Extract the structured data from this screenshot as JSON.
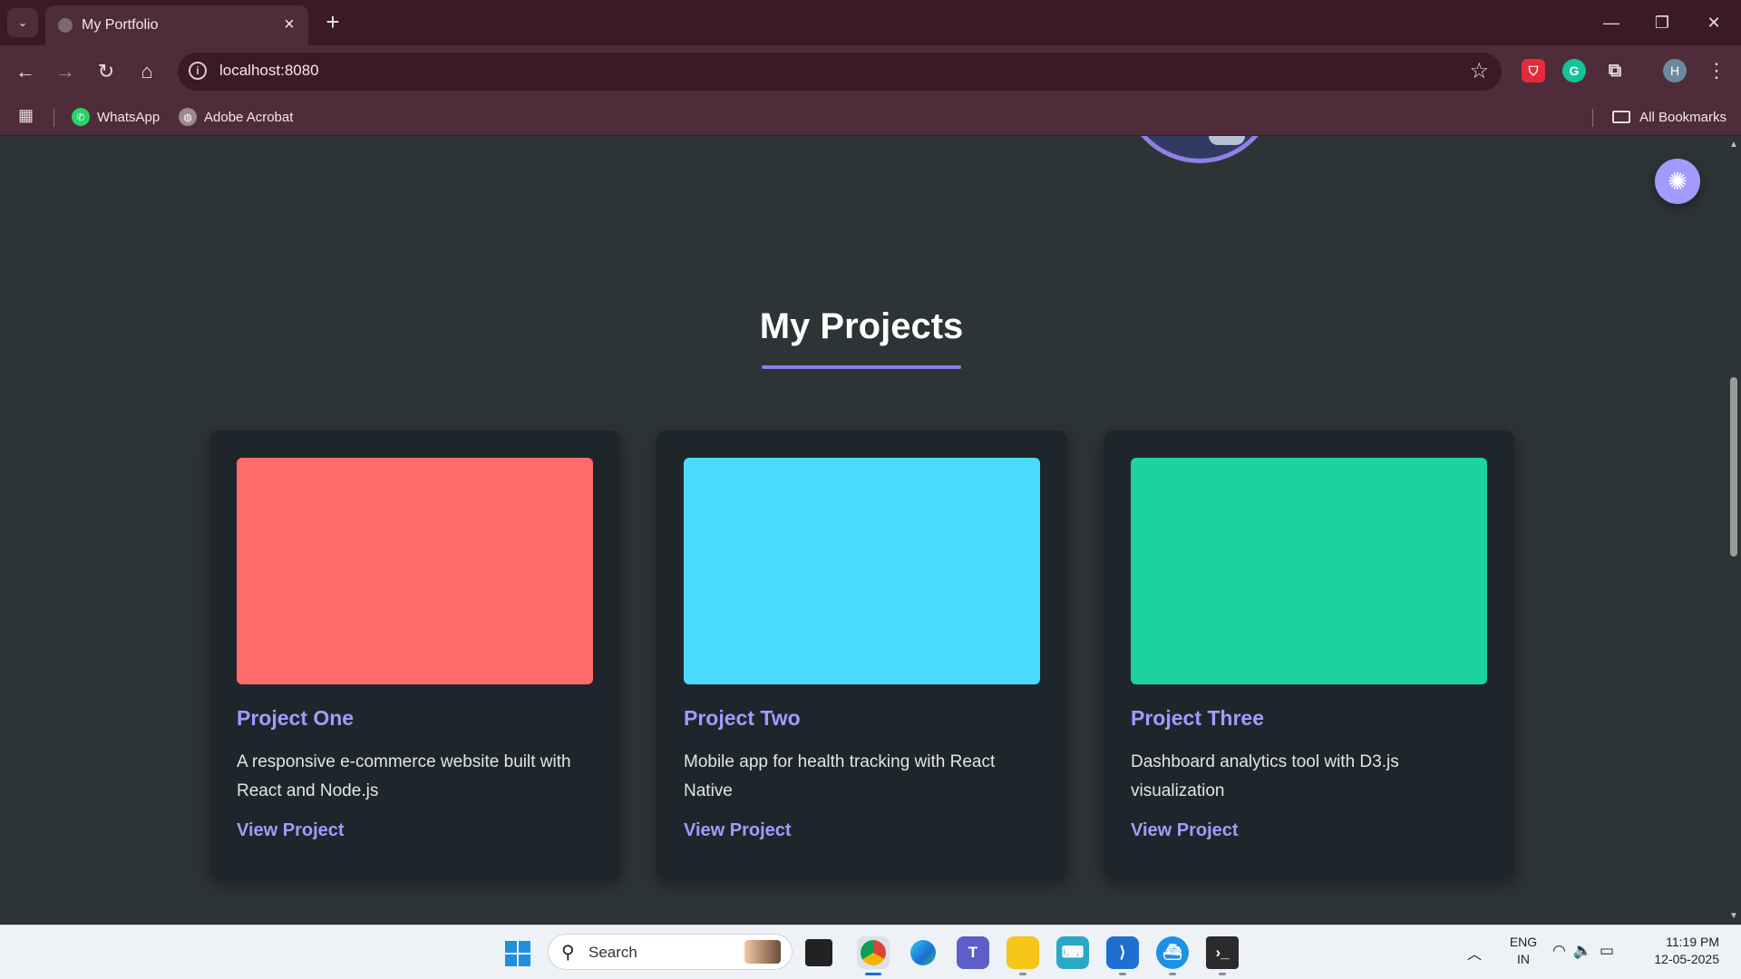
{
  "browser": {
    "tab_title": "My Portfolio",
    "url": "localhost:8080",
    "bookmarks": [
      {
        "label": "WhatsApp",
        "icon": "whatsapp-icon",
        "color": "#25d366"
      },
      {
        "label": "Adobe Acrobat",
        "icon": "globe-icon",
        "color": "#9a8990"
      }
    ],
    "all_bookmarks": "All Bookmarks",
    "profile_initial": "H"
  },
  "page": {
    "section_title": "My Projects",
    "accent_color": "#a29bfe",
    "projects": [
      {
        "title": "Project One",
        "description": "A responsive e-commerce website built with React and Node.js",
        "link": "View Project",
        "thumb_color": "#ff6b6b"
      },
      {
        "title": "Project Two",
        "description": "Mobile app for health tracking with React Native",
        "link": "View Project",
        "thumb_color": "#48dbfb"
      },
      {
        "title": "Project Three",
        "description": "Dashboard analytics tool with D3.js visualization",
        "link": "View Project",
        "thumb_color": "#1dd1a1"
      }
    ]
  },
  "taskbar": {
    "search_placeholder": "Search",
    "language": "ENG",
    "region": "IN",
    "time": "11:19 PM",
    "date": "12-05-2025"
  }
}
